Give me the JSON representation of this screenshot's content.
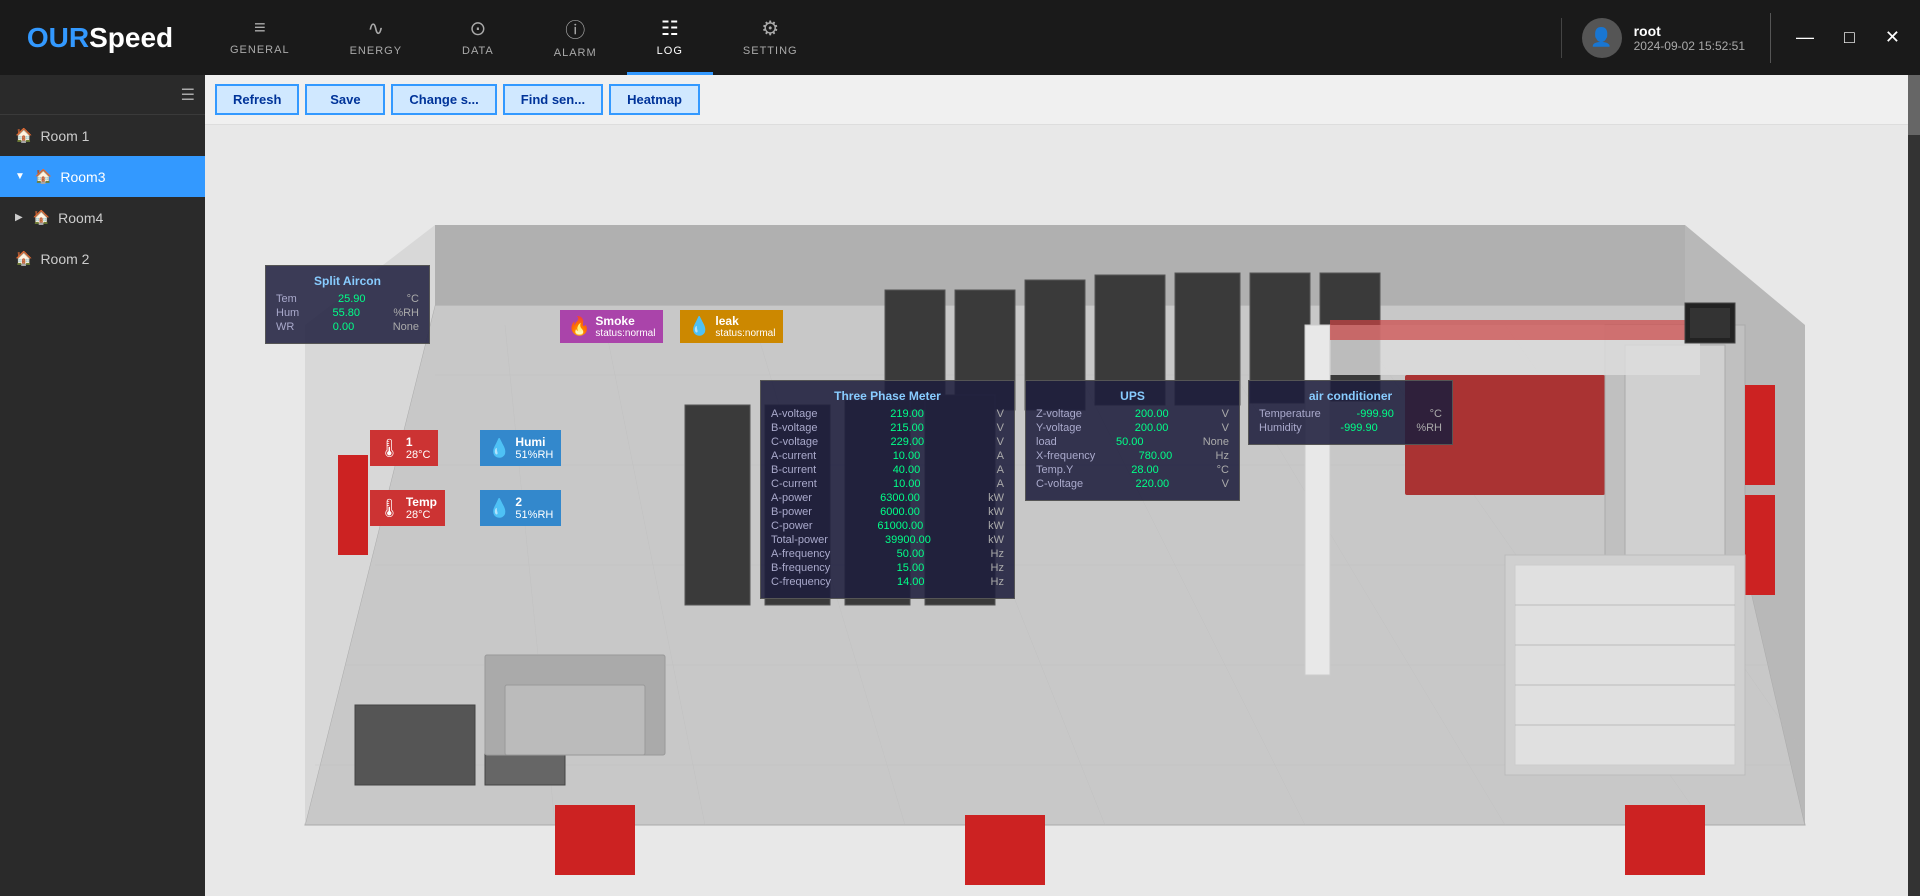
{
  "app": {
    "logo_our": "OUR",
    "logo_speed": "Speed",
    "title": "OURSpeed"
  },
  "nav": {
    "items": [
      {
        "id": "general",
        "label": "GENERAL",
        "icon": "≡"
      },
      {
        "id": "energy",
        "label": "ENERGY",
        "icon": "∿"
      },
      {
        "id": "data",
        "label": "DATA",
        "icon": "⊙"
      },
      {
        "id": "alarm",
        "label": "ALARM",
        "icon": "ⓘ"
      },
      {
        "id": "log",
        "label": "LOG",
        "icon": "≡",
        "active": true
      },
      {
        "id": "setting",
        "label": "SETTING",
        "icon": "⚙"
      }
    ]
  },
  "user": {
    "name": "root",
    "time": "2024-09-02 15:52:51",
    "avatar_icon": "👤"
  },
  "win_controls": {
    "minimize": "—",
    "maximize": "□",
    "close": "✕"
  },
  "toolbar": {
    "buttons": [
      {
        "id": "refresh",
        "label": "Refresh"
      },
      {
        "id": "save",
        "label": "Save"
      },
      {
        "id": "change_s",
        "label": "Change s..."
      },
      {
        "id": "find_sen",
        "label": "Find sen..."
      },
      {
        "id": "heatmap",
        "label": "Heatmap"
      }
    ]
  },
  "sidebar": {
    "items": [
      {
        "id": "room1",
        "label": "Room 1",
        "level": 0,
        "active": false
      },
      {
        "id": "room3",
        "label": "Room3",
        "level": 0,
        "active": true
      },
      {
        "id": "room4",
        "label": "Room4",
        "level": 0,
        "active": false
      },
      {
        "id": "room2",
        "label": "Room 2",
        "level": 0,
        "active": false
      }
    ]
  },
  "panels": {
    "split_aircon": {
      "title": "Split Aircon",
      "rows": [
        {
          "label": "Tem",
          "value": "25.90",
          "unit": "°C"
        },
        {
          "label": "Hum",
          "value": "55.80",
          "unit": "%RH"
        },
        {
          "label": "WR",
          "value": "0.00",
          "unit": "None"
        }
      ]
    },
    "smoke": {
      "name": "Smoke",
      "status": "status:normal"
    },
    "leak": {
      "name": "leak",
      "status": "status:normal"
    },
    "temp1": {
      "name": "1",
      "value": "28°C"
    },
    "humi1": {
      "name": "Humi",
      "value": "51%RH"
    },
    "temp2": {
      "name": "Temp",
      "value": "28°C"
    },
    "humi2": {
      "name": "2",
      "value": "51%RH"
    },
    "three_phase": {
      "title": "Three Phase Meter",
      "rows": [
        {
          "label": "A-voltage",
          "value": "219.00",
          "unit": "V"
        },
        {
          "label": "B-voltage",
          "value": "215.00",
          "unit": "V"
        },
        {
          "label": "C-voltage",
          "value": "229.00",
          "unit": "V"
        },
        {
          "label": "A-current",
          "value": "10.00",
          "unit": "A"
        },
        {
          "label": "B-current",
          "value": "40.00",
          "unit": "A"
        },
        {
          "label": "C-current",
          "value": "10.00",
          "unit": "A"
        },
        {
          "label": "A-power",
          "value": "6300.00",
          "unit": "kW"
        },
        {
          "label": "B-power",
          "value": "6000.00",
          "unit": "kW"
        },
        {
          "label": "C-power",
          "value": "61000.00",
          "unit": "kW"
        },
        {
          "label": "Total-power",
          "value": "39900.00",
          "unit": "kW"
        },
        {
          "label": "A-frequency",
          "value": "50.00",
          "unit": "Hz"
        },
        {
          "label": "B-frequency",
          "value": "15.00",
          "unit": "Hz"
        },
        {
          "label": "C-frequency",
          "value": "14.00",
          "unit": "Hz"
        }
      ]
    },
    "ups": {
      "title": "UPS",
      "rows": [
        {
          "label": "Z-voltage",
          "value": "200.00",
          "unit": "V"
        },
        {
          "label": "Y-voltage",
          "value": "200.00",
          "unit": "V"
        },
        {
          "label": "load",
          "value": "50.00",
          "unit": "None"
        },
        {
          "label": "X-frequency",
          "value": "780.00",
          "unit": "Hz"
        },
        {
          "label": "Temp.Y",
          "value": "28.00",
          "unit": "°C"
        },
        {
          "label": "C-voltage",
          "value": "220.00",
          "unit": "V"
        }
      ]
    },
    "air_conditioner": {
      "title": "air conditioner",
      "rows": [
        {
          "label": "Temperature",
          "value": "-999.90",
          "unit": "°C"
        },
        {
          "label": "Humidity",
          "value": "-999.90",
          "unit": "%RH"
        }
      ]
    }
  }
}
